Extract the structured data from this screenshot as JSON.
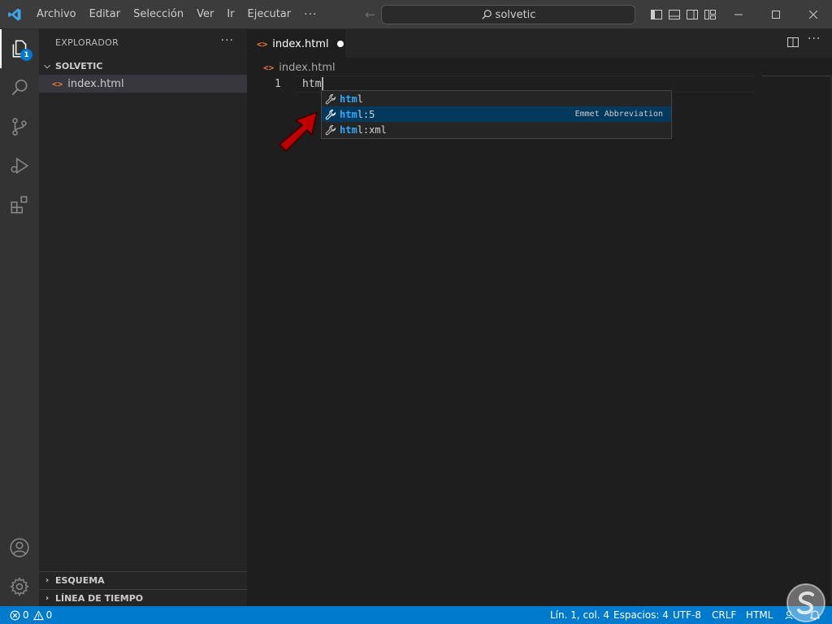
{
  "titlebar": {
    "menu": [
      {
        "label": "Archivo"
      },
      {
        "label": "Editar"
      },
      {
        "label": "Selección"
      },
      {
        "label": "Ver"
      },
      {
        "label": "Ir"
      },
      {
        "label": "Ejecutar"
      }
    ],
    "more": "···",
    "search": "solvetic"
  },
  "activitybar": {
    "explorer_badge": "1"
  },
  "sidebar": {
    "title": "EXPLORADOR",
    "more": "···",
    "folder": "SOLVETIC",
    "file": "index.html",
    "panel_outline": "ESQUEMA",
    "panel_timeline": "LÍNEA DE TIEMPO"
  },
  "editor": {
    "tab_label": "index.html",
    "more": "···",
    "breadcrumb": "index.html",
    "line_number": "1",
    "code": "htm"
  },
  "suggest": {
    "items": [
      {
        "match": "htm",
        "rest": "l",
        "detail": ""
      },
      {
        "match": "htm",
        "rest": "l:5",
        "detail": "Emmet Abbreviation"
      },
      {
        "match": "htm",
        "rest": "l:xml",
        "detail": ""
      }
    ]
  },
  "statusbar": {
    "errors": "0",
    "warnings": "0",
    "position": "Lín. 1, col. 4",
    "spaces": "Espacios: 4",
    "encoding": "UTF-8",
    "eol": "CRLF",
    "language": "HTML"
  },
  "colors": {
    "accent": "#007acc",
    "selection": "#04395e",
    "match": "#2aaaff",
    "html_icon": "#e37933",
    "arrow": "#c00000"
  }
}
